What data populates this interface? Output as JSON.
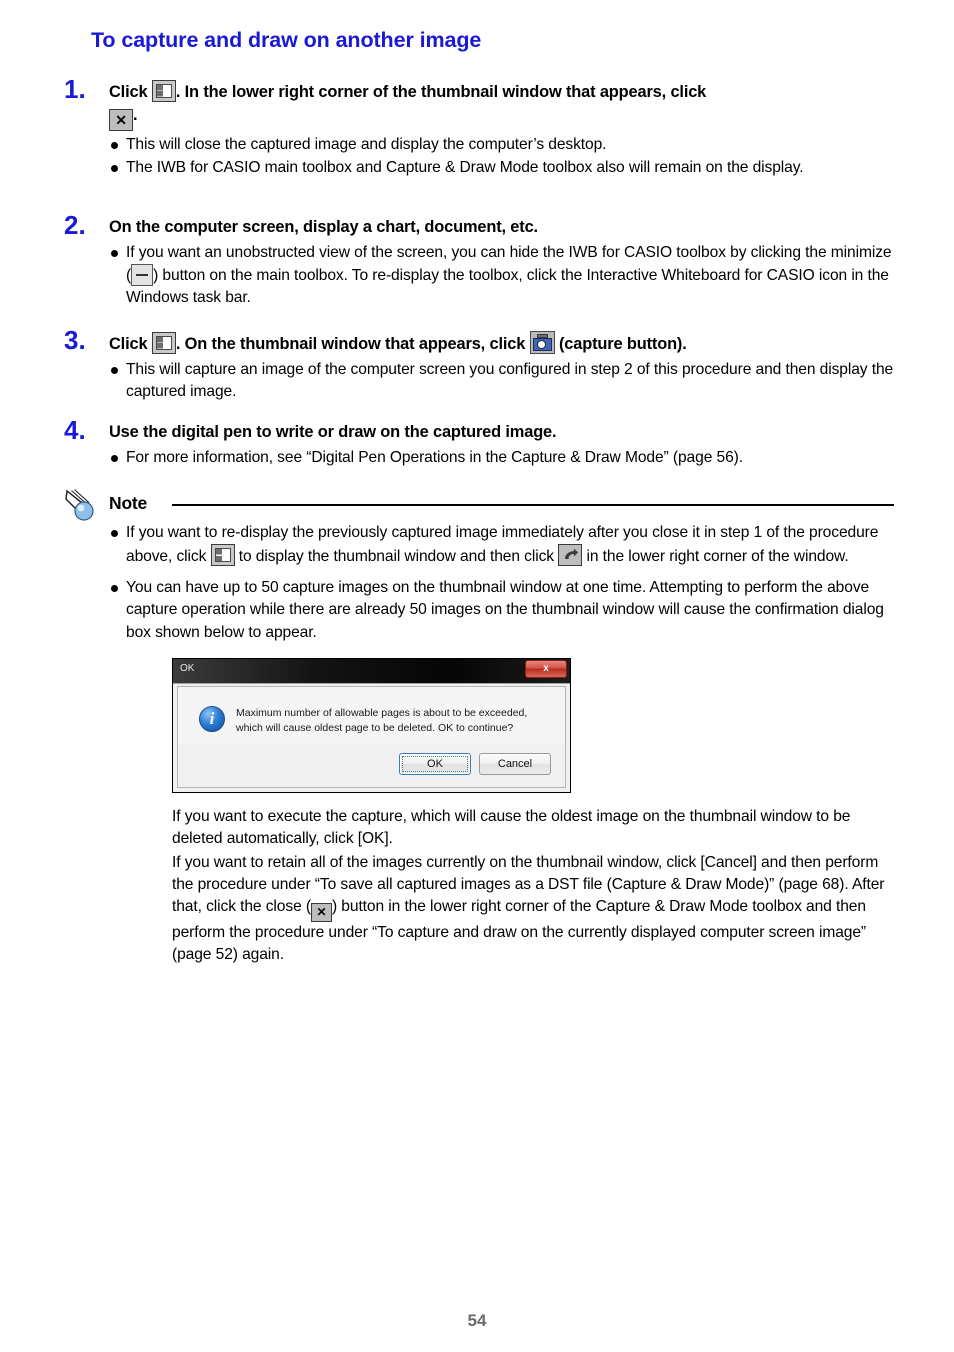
{
  "heading": "To capture and draw on another image",
  "steps": [
    {
      "number": "1.",
      "head_a": "Click",
      "head_b": ". In the lower right corner of the thumbnail window that appears, click",
      "head_c": ".",
      "bullets": [
        "This will close the captured image and display the computer’s desktop.",
        "The IWB for CASIO main toolbox and Capture & Draw Mode toolbox also will remain on the display."
      ]
    },
    {
      "number": "2.",
      "head_a": "On the computer screen, display a chart, document, etc.",
      "bullet_a": "If you want an unobstructed view of the screen, you can hide the IWB for CASIO toolbox by clicking the minimize (",
      "bullet_b": ") button on the main toolbox. To re-display the toolbox, click the Interactive Whiteboard for CASIO icon in the Windows task bar."
    },
    {
      "number": "3.",
      "head_a": "Click",
      "head_b": ". On the thumbnail window that appears, click",
      "head_c": "(capture button).",
      "bullets": [
        "This will capture an image of the computer screen you configured in step 2 of this procedure and then display the captured image."
      ]
    },
    {
      "number": "4.",
      "head_a": "Use the digital pen to write or draw on the captured image.",
      "bullets": [
        "For more information, see “Digital Pen Operations in the Capture & Draw Mode” (page 56)."
      ]
    }
  ],
  "note": {
    "label": "Note",
    "bullet1_a": "If you want to re-display the previously captured image immediately after you close it in step 1 of the procedure above, click",
    "bullet1_b": "to display the thumbnail window and then click",
    "bullet1_c": "in the lower right corner of the window.",
    "bullet2": "You can have up to 50 capture images on the thumbnail window at one time. Attempting to perform the above capture operation while there are already 50 images on the thumbnail window will cause the confirmation dialog box shown below to appear."
  },
  "dialog": {
    "title": "OK",
    "close_label": "x",
    "info_glyph": "i",
    "message": "Maximum number of allowable pages is about to be exceeded, which will cause oldest page to be deleted. OK to continue?",
    "ok_label": "OK",
    "cancel_label": "Cancel"
  },
  "tail": {
    "p1": "If you want to execute the capture, which will cause the oldest image on the thumbnail window to be deleted automatically, click [OK].",
    "p2_a": "If you want to retain all of the images currently on the thumbnail window, click [Cancel] and then perform the procedure under “To save all captured images as a DST file (Capture & Draw Mode)” (page 68). After that, click the close (",
    "p2_b": ") button in the lower right corner of the Capture & Draw Mode toolbox and then perform the procedure under “To capture and draw on the currently displayed computer screen image” (page 52) again."
  },
  "icons": {
    "thumbnail": "thumbnail-window-icon",
    "close": "✕",
    "minimize": "minimize-icon",
    "camera": "camera-capture-icon",
    "redo": "redisplay-arrow-icon",
    "note": "pencil-note-icon"
  },
  "footer": {
    "page_number": "54"
  },
  "colors": {
    "heading": "#1a19d6",
    "step_number": "#1a19d6",
    "body_text": "#000000",
    "page_number": "#6b6b6b",
    "dialog_close": "#b52d1d",
    "dialog_info": "#0b4a9c"
  }
}
